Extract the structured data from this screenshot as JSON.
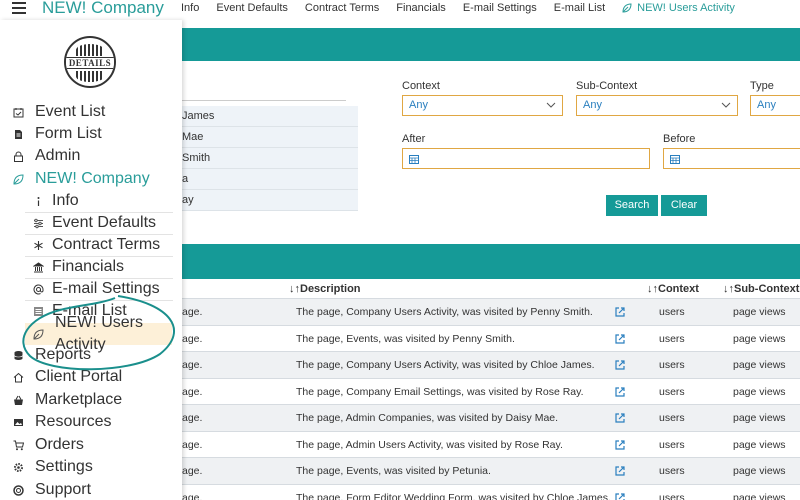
{
  "app": {
    "brand": "NEW! Company"
  },
  "topnav": {
    "items": [
      "Info",
      "Event Defaults",
      "Contract Terms",
      "Financials",
      "E-mail Settings",
      "E-mail List"
    ],
    "active": "NEW! Users Activity"
  },
  "sidebar": {
    "logo_text": "DETAILS",
    "items": [
      {
        "label": "Event List",
        "icon": "calendar-check-icon"
      },
      {
        "label": "Form List",
        "icon": "document-icon"
      },
      {
        "label": "Admin",
        "icon": "lock-icon"
      },
      {
        "label": "NEW! Company",
        "icon": "leaf-icon"
      }
    ],
    "company_sub": [
      {
        "label": "Info",
        "icon": "info-icon"
      },
      {
        "label": "Event Defaults",
        "icon": "sliders-icon"
      },
      {
        "label": "Contract Terms",
        "icon": "asterisk-icon"
      },
      {
        "label": "Financials",
        "icon": "bank-icon"
      },
      {
        "label": "E-mail Settings",
        "icon": "at-icon"
      },
      {
        "label": "E-mail List",
        "icon": "list-icon"
      },
      {
        "label": "NEW! Users Activity",
        "icon": "leaf-icon"
      }
    ],
    "bottom_items": [
      {
        "label": "Reports",
        "icon": "database-icon"
      },
      {
        "label": "Client Portal",
        "icon": "house-icon"
      },
      {
        "label": "Marketplace",
        "icon": "basket-icon"
      },
      {
        "label": "Resources",
        "icon": "images-icon"
      },
      {
        "label": "Orders",
        "icon": "cart-icon"
      },
      {
        "label": "Settings",
        "icon": "gear-icon"
      },
      {
        "label": "Support",
        "icon": "support-icon"
      }
    ]
  },
  "users_partial": [
    "James",
    "Mae",
    "Smith",
    "a",
    "ay"
  ],
  "filters": {
    "context_label": "Context",
    "context_value": "Any",
    "subcontext_label": "Sub-Context",
    "subcontext_value": "Any",
    "type_label": "Type",
    "type_value": "Any",
    "after_label": "After",
    "before_label": "Before",
    "search_label": "Search",
    "clear_label": "Clear"
  },
  "table": {
    "headers": {
      "description": "Description",
      "context": "Context",
      "subcontext": "Sub-Context"
    },
    "rows": [
      {
        "lead": "age.",
        "description": "The page, Company Users Activity, was visited by Penny Smith.",
        "context": "users",
        "subcontext": "page views"
      },
      {
        "lead": "age.",
        "description": "The page, Events, was visited by Penny Smith.",
        "context": "users",
        "subcontext": "page views"
      },
      {
        "lead": "age.",
        "description": "The page, Company Users Activity, was visited by Chloe James.",
        "context": "users",
        "subcontext": "page views"
      },
      {
        "lead": "age.",
        "description": "The page, Company Email Settings, was visited by Rose Ray.",
        "context": "users",
        "subcontext": "page views"
      },
      {
        "lead": "age.",
        "description": "The page, Admin Companies, was visited by Daisy Mae.",
        "context": "users",
        "subcontext": "page views"
      },
      {
        "lead": "age.",
        "description": "The page, Admin Users Activity, was visited by Rose Ray.",
        "context": "users",
        "subcontext": "page views"
      },
      {
        "lead": "age.",
        "description": "The page, Events, was visited by Petunia.",
        "context": "users",
        "subcontext": "page views"
      },
      {
        "lead": "age.",
        "description": "The page, Form Editor Wedding Form, was visited by Chloe James.",
        "context": "users",
        "subcontext": "page views"
      }
    ]
  },
  "colors": {
    "teal": "#159a97",
    "accent_text": "#2a9d9a",
    "input_border": "#e0a743",
    "active_bg": "#fdf0d8"
  }
}
